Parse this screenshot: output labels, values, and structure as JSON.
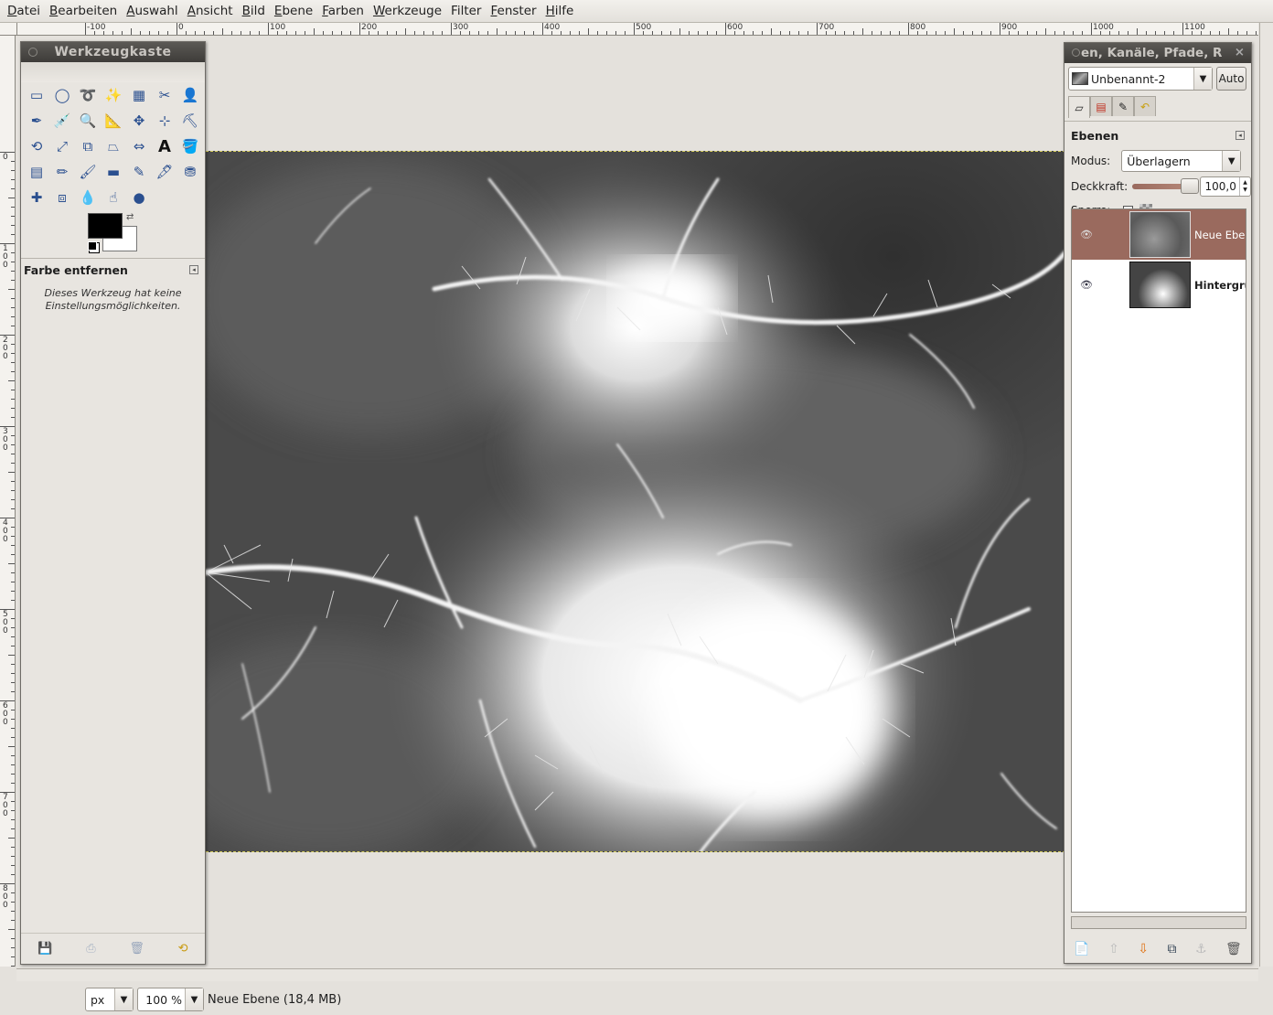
{
  "menu": [
    {
      "label": "Datei"
    },
    {
      "label": "Bearbeiten"
    },
    {
      "label": "Auswahl"
    },
    {
      "label": "Ansicht"
    },
    {
      "label": "Bild"
    },
    {
      "label": "Ebene"
    },
    {
      "label": "Farben"
    },
    {
      "label": "Werkzeuge"
    },
    {
      "label": "Filter"
    },
    {
      "label": "Fenster"
    },
    {
      "label": "Hilfe"
    }
  ],
  "ruler_top": [
    "-100",
    "0",
    "100",
    "200",
    "300",
    "400",
    "500",
    "600",
    "700",
    "800",
    "900",
    "1000",
    "1100"
  ],
  "ruler_left": [
    "0",
    "100",
    "200",
    "300",
    "400",
    "500",
    "600",
    "700",
    "800"
  ],
  "toolbox": {
    "title": "Werkzeugkaste",
    "tools": [
      {
        "icon": "rect-select-icon",
        "glyph": "▭"
      },
      {
        "icon": "ellipse-select-icon",
        "glyph": "◯"
      },
      {
        "icon": "lasso-icon",
        "glyph": "➰"
      },
      {
        "icon": "fuzzy-select-icon",
        "glyph": "✨"
      },
      {
        "icon": "select-by-color-icon",
        "glyph": "▦"
      },
      {
        "icon": "scissors-icon",
        "glyph": "✂"
      },
      {
        "icon": "foreground-select-icon",
        "glyph": "👤"
      },
      {
        "icon": "paths-icon",
        "glyph": "✒"
      },
      {
        "icon": "color-picker-icon",
        "glyph": "💉"
      },
      {
        "icon": "zoom-icon",
        "glyph": "🔍"
      },
      {
        "icon": "measure-icon",
        "glyph": "📐"
      },
      {
        "icon": "move-icon",
        "glyph": "✥"
      },
      {
        "icon": "align-icon",
        "glyph": "⊹"
      },
      {
        "icon": "crop-icon",
        "glyph": "⛏"
      },
      {
        "icon": "rotate-icon",
        "glyph": "⟲"
      },
      {
        "icon": "scale-icon",
        "glyph": "⤢"
      },
      {
        "icon": "shear-icon",
        "glyph": "⧉"
      },
      {
        "icon": "perspective-icon",
        "glyph": "⏢"
      },
      {
        "icon": "flip-icon",
        "glyph": "⇔"
      },
      {
        "icon": "text-icon",
        "glyph": "A"
      },
      {
        "icon": "bucket-fill-icon",
        "glyph": "🪣"
      },
      {
        "icon": "blend-icon",
        "glyph": "▤"
      },
      {
        "icon": "pencil-icon",
        "glyph": "✏"
      },
      {
        "icon": "paintbrush-icon",
        "glyph": "🖌"
      },
      {
        "icon": "eraser-icon",
        "glyph": "▬"
      },
      {
        "icon": "airbrush-icon",
        "glyph": "✎"
      },
      {
        "icon": "ink-icon",
        "glyph": "🖋"
      },
      {
        "icon": "clone-icon",
        "glyph": "⛃"
      },
      {
        "icon": "heal-icon",
        "glyph": "✚"
      },
      {
        "icon": "perspective-clone-icon",
        "glyph": "⧈"
      },
      {
        "icon": "blur-icon",
        "glyph": "💧"
      },
      {
        "icon": "smudge-icon",
        "glyph": "☝"
      },
      {
        "icon": "dodge-burn-icon",
        "glyph": "●"
      }
    ],
    "options_title": "Farbe entfernen",
    "options_text_1": "Dieses Werkzeug hat keine",
    "options_text_2": "Einstellungsmöglichkeiten.",
    "bottom_icons": [
      "save-icon",
      "restore-icon",
      "delete-icon",
      "reset-icon"
    ]
  },
  "dock": {
    "title": "en, Kanäle, Pfade, R",
    "image_name": "Unbenannt-2",
    "auto_label": "Auto",
    "panel_title": "Ebenen",
    "mode_label": "Modus:",
    "mode_value": "Überlagern",
    "opacity_label": "Deckkraft:",
    "opacity_value": "100,0",
    "lock_label": "Sperre:",
    "layers": [
      {
        "name": "Neue Ebene",
        "selected": true,
        "visible": true
      },
      {
        "name": "Hintergrund",
        "selected": false,
        "visible": true
      }
    ],
    "bottom_icons": [
      "new-layer-icon",
      "raise-layer-icon",
      "lower-layer-icon",
      "duplicate-layer-icon",
      "anchor-layer-icon",
      "delete-layer-icon"
    ]
  },
  "status": {
    "unit": "px",
    "zoom": "100 %",
    "message": "Neue Ebene (18,4 MB)"
  }
}
